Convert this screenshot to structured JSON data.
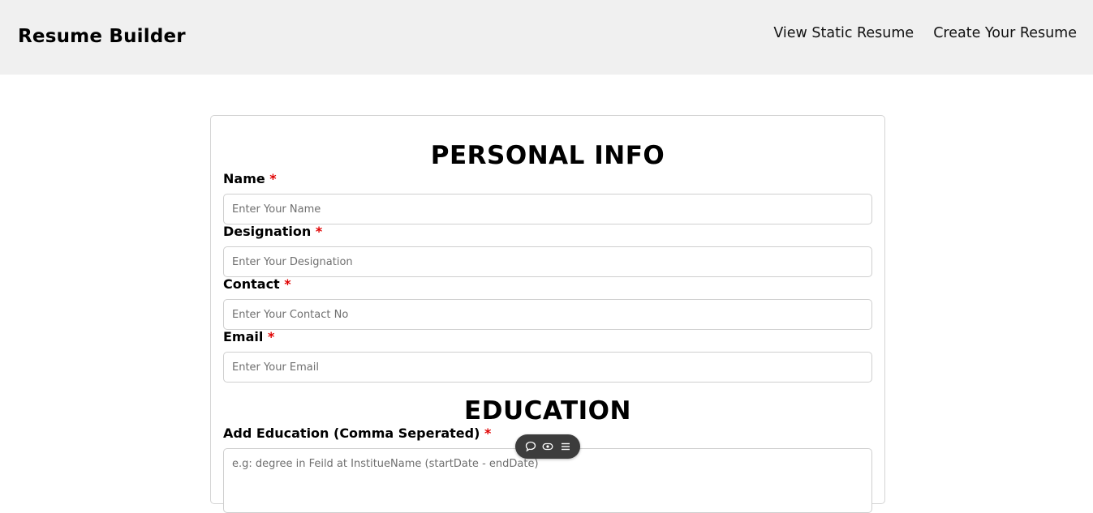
{
  "header": {
    "brand": "Resume Builder",
    "nav": {
      "view_static": "View Static Resume",
      "create": "Create Your Resume"
    }
  },
  "personal_info": {
    "title": "PERSONAL INFO",
    "required_mark": "*",
    "fields": {
      "name": {
        "label": "Name",
        "placeholder": "Enter Your Name",
        "value": ""
      },
      "designation": {
        "label": "Designation",
        "placeholder": "Enter Your Designation",
        "value": ""
      },
      "contact": {
        "label": "Contact",
        "placeholder": "Enter Your Contact No",
        "value": ""
      },
      "email": {
        "label": "Email",
        "placeholder": "Enter Your Email",
        "value": ""
      }
    }
  },
  "education": {
    "title": "EDUCATION",
    "required_mark": "*",
    "field": {
      "label": "Add Education (Comma Seperated)",
      "placeholder": "e.g: degree in Feild at InstitueName (startDate - endDate)",
      "value": ""
    }
  },
  "floating_toolbar": {
    "icons": [
      "comment-icon",
      "eye-icon",
      "menu-icon"
    ]
  },
  "colors": {
    "header_bg": "#f0f0f0",
    "required": "#e00000",
    "border": "#cfcfcf",
    "toolbar_bg": "#3c3c3c"
  }
}
